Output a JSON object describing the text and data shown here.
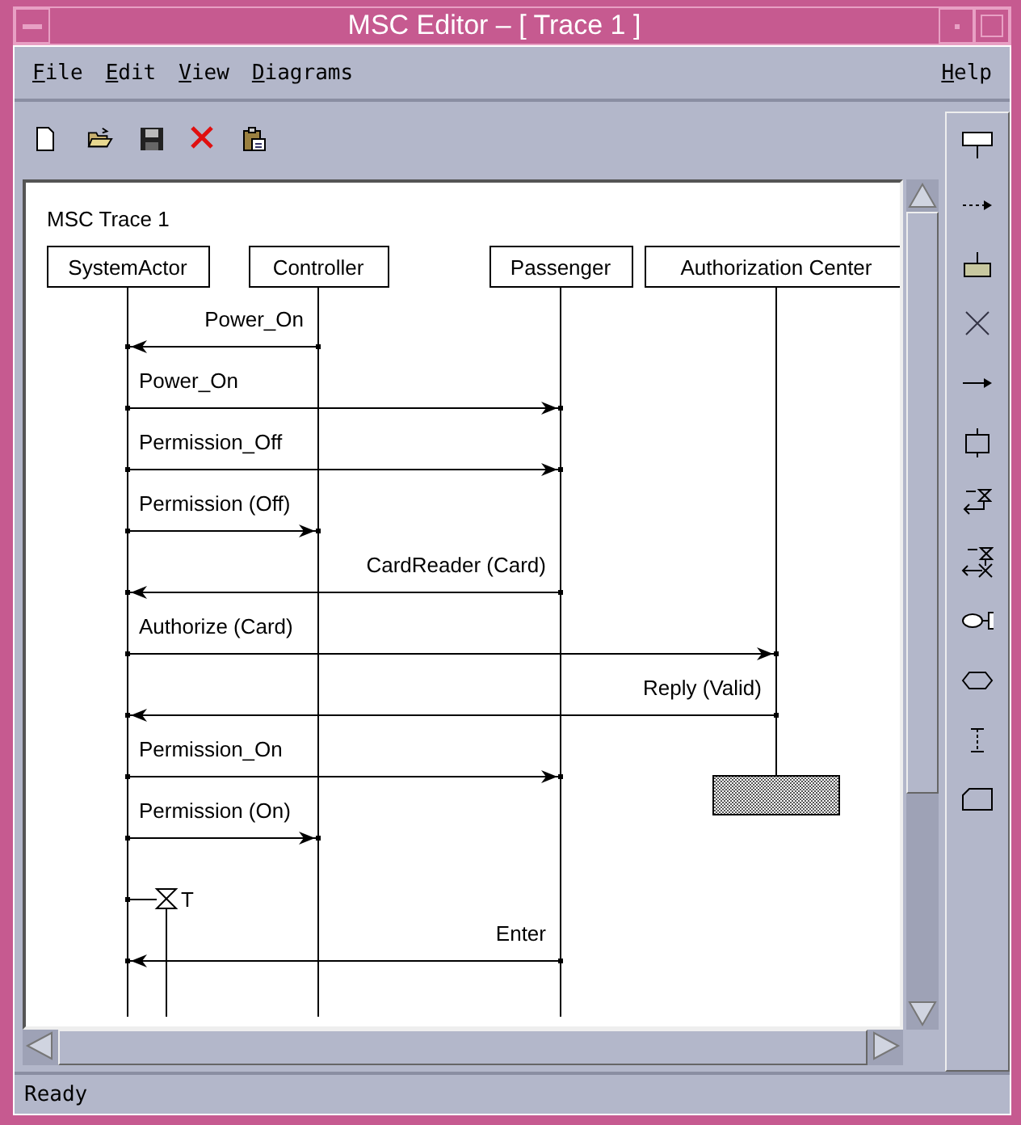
{
  "window": {
    "title": "MSC Editor – [ Trace 1 ]"
  },
  "menu": [
    {
      "label": "File",
      "right_aligned": false
    },
    {
      "label": "Edit",
      "right_aligned": false
    },
    {
      "label": "View",
      "right_aligned": false
    },
    {
      "label": "Diagrams",
      "right_aligned": false
    },
    {
      "label": "Help",
      "right_aligned": true
    }
  ],
  "toolbar": [
    {
      "kind": "new"
    },
    {
      "kind": "open"
    },
    {
      "kind": "save"
    },
    {
      "kind": "delete"
    },
    {
      "kind": "paste"
    }
  ],
  "palette": [
    {
      "kind": "instance"
    },
    {
      "kind": "create"
    },
    {
      "kind": "action"
    },
    {
      "kind": "stop"
    },
    {
      "kind": "message"
    },
    {
      "kind": "condition"
    },
    {
      "kind": "timer-set"
    },
    {
      "kind": "timer-reset"
    },
    {
      "kind": "gate"
    },
    {
      "kind": "hexagon"
    },
    {
      "kind": "coregion"
    },
    {
      "kind": "note"
    }
  ],
  "diagram": {
    "title": "MSC Trace 1",
    "instances": [
      {
        "name": "SystemActor"
      },
      {
        "name": "Controller"
      },
      {
        "name": "Passenger"
      },
      {
        "name": "Authorization Center"
      }
    ],
    "events": [
      {
        "kind": "message",
        "label": "Power_On",
        "lanes": [
          {
            "kind": "head"
          },
          {
            "kind": "tail"
          },
          {
            "kind": "none"
          },
          {
            "kind": "none"
          }
        ]
      },
      {
        "kind": "message",
        "label": "Power_On",
        "lanes": [
          {
            "kind": "tail"
          },
          {
            "kind": "none"
          },
          {
            "kind": "head"
          },
          {
            "kind": "none"
          }
        ]
      },
      {
        "kind": "message",
        "label": "Permission_Off",
        "lanes": [
          {
            "kind": "tail"
          },
          {
            "kind": "none"
          },
          {
            "kind": "head"
          },
          {
            "kind": "none"
          }
        ]
      },
      {
        "kind": "message",
        "label": "Permission (Off)",
        "lanes": [
          {
            "kind": "tail"
          },
          {
            "kind": "head"
          },
          {
            "kind": "none"
          },
          {
            "kind": "none"
          }
        ]
      },
      {
        "kind": "message",
        "label": "CardReader (Card)",
        "lanes": [
          {
            "kind": "head"
          },
          {
            "kind": "none"
          },
          {
            "kind": "tail"
          },
          {
            "kind": "none"
          }
        ]
      },
      {
        "kind": "message",
        "label": "Authorize (Card)",
        "lanes": [
          {
            "kind": "tail"
          },
          {
            "kind": "none"
          },
          {
            "kind": "none"
          },
          {
            "kind": "head"
          }
        ]
      },
      {
        "kind": "message",
        "label": "Reply (Valid)",
        "lanes": [
          {
            "kind": "head"
          },
          {
            "kind": "none"
          },
          {
            "kind": "none"
          },
          {
            "kind": "tail"
          }
        ]
      },
      {
        "kind": "stop",
        "lanes": [
          {
            "kind": "none"
          },
          {
            "kind": "none"
          },
          {
            "kind": "none"
          },
          {
            "kind": "stop"
          }
        ]
      },
      {
        "kind": "message",
        "label": "Permission_On",
        "lanes": [
          {
            "kind": "tail"
          },
          {
            "kind": "none"
          },
          {
            "kind": "head"
          },
          {
            "kind": "none"
          }
        ]
      },
      {
        "kind": "message",
        "label": "Permission (On)",
        "lanes": [
          {
            "kind": "tail"
          },
          {
            "kind": "head"
          },
          {
            "kind": "none"
          },
          {
            "kind": "none"
          }
        ]
      },
      {
        "kind": "timer",
        "label": "T",
        "lanes": [
          {
            "kind": "timer"
          },
          {
            "kind": "none"
          },
          {
            "kind": "none"
          },
          {
            "kind": "none"
          }
        ]
      },
      {
        "kind": "message",
        "label": "Enter",
        "lanes": [
          {
            "kind": "head"
          },
          {
            "kind": "none"
          },
          {
            "kind": "tail"
          },
          {
            "kind": "none"
          }
        ]
      }
    ]
  },
  "status_bar": {
    "text": "Ready"
  }
}
